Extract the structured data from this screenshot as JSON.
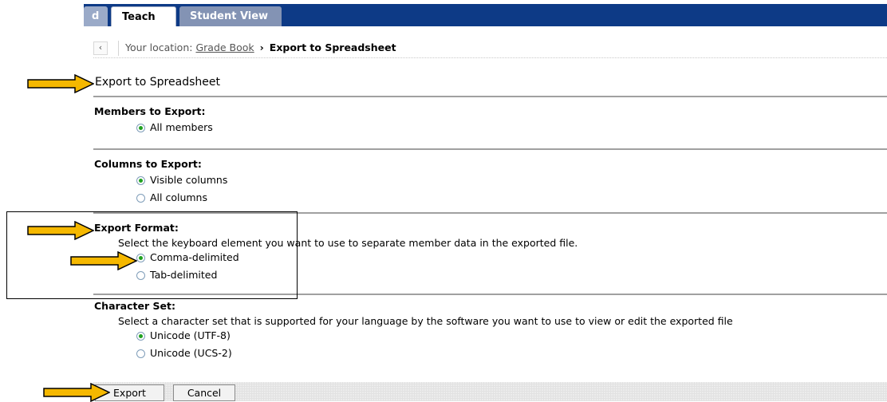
{
  "tabs": {
    "partial_label": "d",
    "teach_label": "Teach",
    "student_label": "Student View"
  },
  "location": {
    "back_glyph": "‹",
    "prefix": "Your location:",
    "link": "Grade Book",
    "arrow": "›",
    "current": "Export to Spreadsheet"
  },
  "page": {
    "title": "Export to Spreadsheet"
  },
  "members": {
    "heading": "Members to Export:",
    "options": [
      {
        "label": "All members",
        "checked": true
      }
    ]
  },
  "columns": {
    "heading": "Columns to Export:",
    "options": [
      {
        "label": "Visible columns",
        "checked": true
      },
      {
        "label": "All columns",
        "checked": false
      }
    ]
  },
  "format": {
    "heading": "Export Format:",
    "description": "Select the keyboard element you want to use to separate member data in the exported file.",
    "options": [
      {
        "label": "Comma-delimited",
        "checked": true
      },
      {
        "label": "Tab-delimited",
        "checked": false
      }
    ]
  },
  "charset": {
    "heading": "Character Set:",
    "description": "Select a character set that is supported for your language by the software you want to use to view or edit the exported file",
    "options": [
      {
        "label": "Unicode (UTF-8)",
        "checked": true
      },
      {
        "label": "Unicode (UCS-2)",
        "checked": false
      }
    ]
  },
  "actions": {
    "export_label": "Export",
    "cancel_label": "Cancel"
  },
  "colors": {
    "tabbar": "#0d3a86",
    "radio_selected": "#21a121",
    "arrow_fill": "#f5b800",
    "arrow_outline": "#000000"
  },
  "annotations": {
    "arrow_icon": "yellow-right-arrow"
  }
}
